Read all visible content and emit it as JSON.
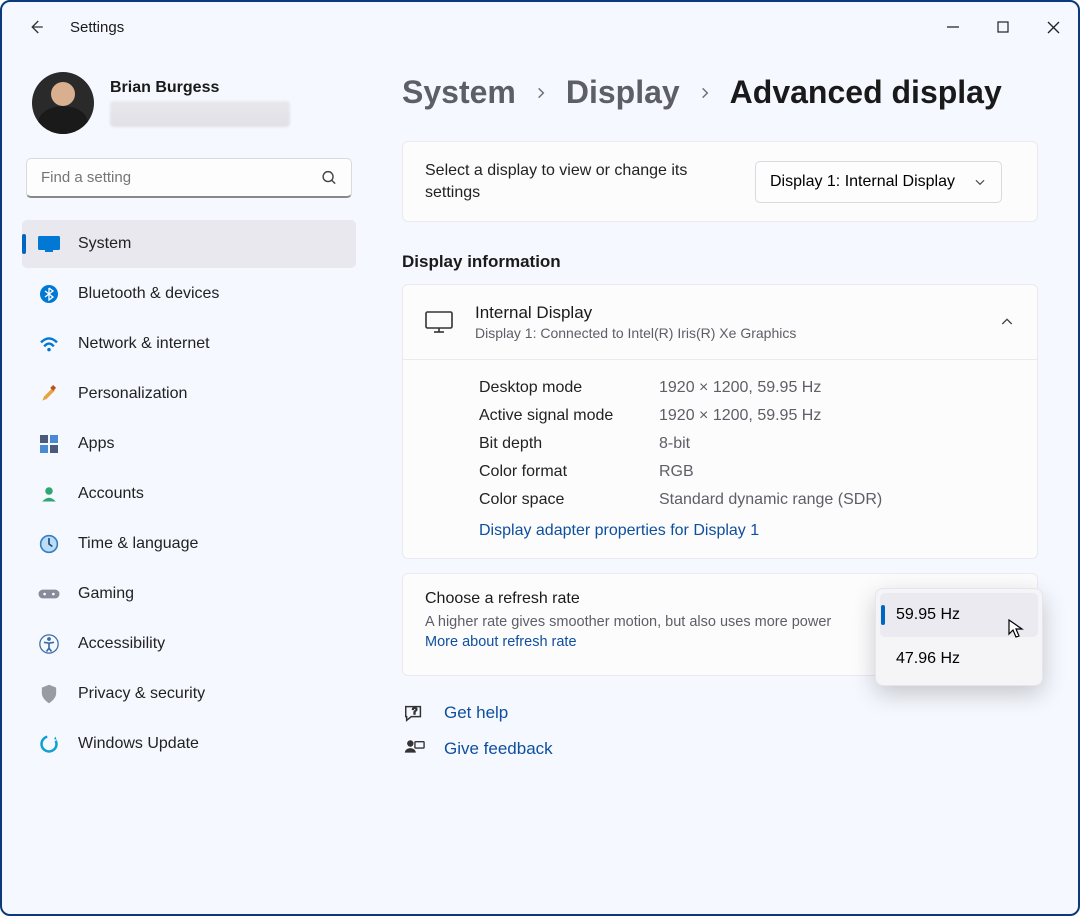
{
  "title": "Settings",
  "profile": {
    "name": "Brian Burgess"
  },
  "search": {
    "placeholder": "Find a setting"
  },
  "nav": [
    {
      "label": "System"
    },
    {
      "label": "Bluetooth & devices"
    },
    {
      "label": "Network & internet"
    },
    {
      "label": "Personalization"
    },
    {
      "label": "Apps"
    },
    {
      "label": "Accounts"
    },
    {
      "label": "Time & language"
    },
    {
      "label": "Gaming"
    },
    {
      "label": "Accessibility"
    },
    {
      "label": "Privacy & security"
    },
    {
      "label": "Windows Update"
    }
  ],
  "breadcrumb": {
    "a": "System",
    "b": "Display",
    "c": "Advanced display"
  },
  "select_display": {
    "prompt": "Select a display to view or change its settings",
    "value": "Display 1: Internal Display"
  },
  "section_info": "Display information",
  "info": {
    "title": "Internal Display",
    "subtitle": "Display 1: Connected to Intel(R) Iris(R) Xe Graphics",
    "rows": {
      "desktop_mode_k": "Desktop mode",
      "desktop_mode_v": "1920 × 1200, 59.95 Hz",
      "active_signal_k": "Active signal mode",
      "active_signal_v": "1920 × 1200, 59.95 Hz",
      "bit_depth_k": "Bit depth",
      "bit_depth_v": "8-bit",
      "color_format_k": "Color format",
      "color_format_v": "RGB",
      "color_space_k": "Color space",
      "color_space_v": "Standard dynamic range (SDR)"
    },
    "adapter_link": "Display adapter properties for Display 1"
  },
  "refresh": {
    "title": "Choose a refresh rate",
    "sub_a": "A higher rate gives smoother motion, but also uses more power  ",
    "more_link": "More about refresh rate",
    "options": {
      "a": "59.95 Hz",
      "b": "47.96 Hz"
    }
  },
  "footer": {
    "help": "Get help",
    "feedback": "Give feedback"
  }
}
